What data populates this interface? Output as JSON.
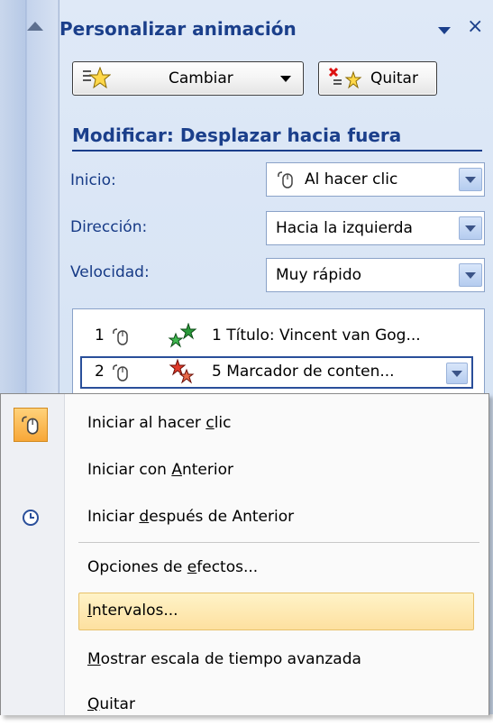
{
  "pane": {
    "title": "Personalizar animación",
    "buttons": {
      "change": "Cambiar",
      "remove": "Quitar"
    },
    "modify_heading": "Modificar: Desplazar hacia fuera",
    "fields": {
      "start_label": "Inicio:",
      "start_value": "Al hacer clic",
      "direction_label": "Dirección:",
      "direction_value": "Hacia la izquierda",
      "speed_label": "Velocidad:",
      "speed_value": "Muy rápido"
    },
    "animation_list": [
      {
        "num": "1",
        "text": "1 Título: Vincent van Gog..."
      },
      {
        "num": "2",
        "text": "5 Marcador de conten..."
      }
    ]
  },
  "menu": {
    "items": [
      {
        "pre": "Iniciar al hacer ",
        "u": "c",
        "post": "lic"
      },
      {
        "pre": "Iniciar con ",
        "u": "A",
        "post": "nterior"
      },
      {
        "pre": "Iniciar ",
        "u": "d",
        "post": "espués de Anterior"
      },
      {
        "pre": "Opciones de ",
        "u": "e",
        "post": "fectos..."
      },
      {
        "pre": "",
        "u": "I",
        "post": "ntervalos..."
      },
      {
        "pre": "",
        "u": "M",
        "post": "ostrar escala de tiempo avanzada"
      },
      {
        "pre": "",
        "u": "Q",
        "post": "uitar"
      }
    ]
  },
  "colors": {
    "accent_blue": "#1b3f8b",
    "highlight": "#fde0a0"
  }
}
